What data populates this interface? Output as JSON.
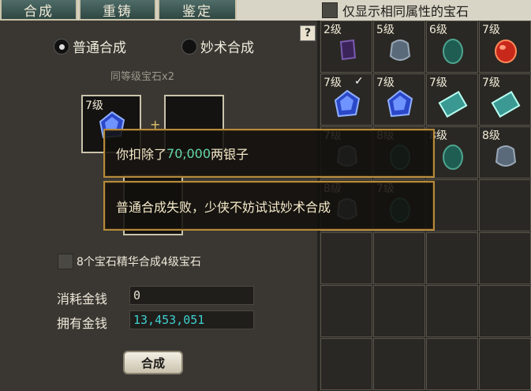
{
  "tabs": [
    {
      "label": "合成"
    },
    {
      "label": "重铸"
    },
    {
      "label": "鉴定"
    }
  ],
  "filter": {
    "label": "仅显示相同属性的宝石",
    "checked": false
  },
  "help": {
    "label": "?"
  },
  "mode": {
    "normal": {
      "label": "普通合成",
      "selected": true
    },
    "miao": {
      "label": "妙术合成",
      "selected": false
    }
  },
  "subhint": "同等级宝石x2",
  "slots": {
    "left": {
      "level": "7级",
      "gem": "blue-crystal"
    },
    "plus": "+",
    "right": {
      "level": "",
      "gem": ""
    }
  },
  "essence": {
    "label": "8个宝石精华合成4级宝石",
    "checked": false
  },
  "money": {
    "cost_label": "消耗金钱",
    "cost_value": "0",
    "owned_label": "拥有金钱",
    "owned_value": "13,453,051",
    "owned_color": "#3fcfd0"
  },
  "compose_button": "合成",
  "messages": {
    "deduct_prefix": "你扣除了",
    "deduct_amount": "70,000",
    "deduct_suffix": "两银子",
    "fail": "普通合成失败，少侠不妨试试妙术合成"
  },
  "grid": [
    {
      "level": "2级",
      "gem": "purple-shard"
    },
    {
      "level": "5级",
      "gem": "grey-stone"
    },
    {
      "level": "6级",
      "gem": "green-stone"
    },
    {
      "level": "7级",
      "gem": "red-ruby"
    },
    {
      "level": "7级",
      "gem": "blue-crystal",
      "check": "✓"
    },
    {
      "level": "7级",
      "gem": "blue-crystal"
    },
    {
      "level": "7级",
      "gem": "teal-tablet"
    },
    {
      "level": "7级",
      "gem": "teal-tablet"
    },
    {
      "level": "7级",
      "gem": "grey-stone"
    },
    {
      "level": "8级",
      "gem": "green-stone"
    },
    {
      "level": "8级",
      "gem": "green-stone"
    },
    {
      "level": "8级",
      "gem": "grey-stone"
    },
    {
      "level": "8级",
      "gem": "grey-stone"
    },
    {
      "level": "7级",
      "gem": "green-stone"
    }
  ],
  "colors": {
    "accent_border": "#b58a3c",
    "money_green": "#62d9a8"
  }
}
